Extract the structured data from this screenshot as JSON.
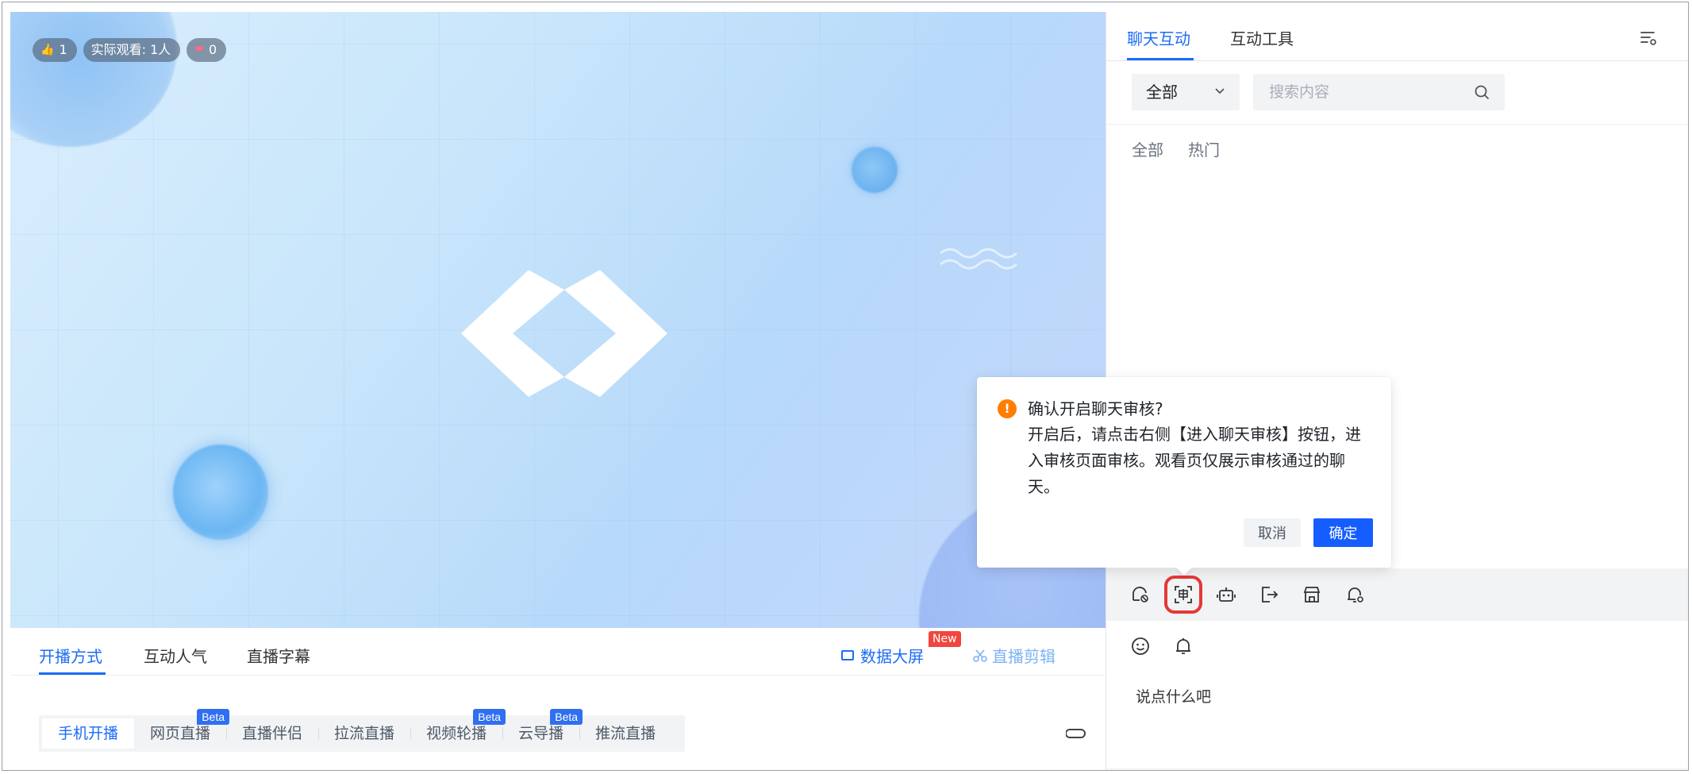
{
  "video": {
    "badges": [
      {
        "icon": "finger-icon",
        "glyph": "👍",
        "value": "1"
      },
      {
        "label": "实际观看: 1人"
      },
      {
        "icon": "heart-icon",
        "glyph": "❤",
        "value": "0"
      }
    ]
  },
  "bottom_tabs": {
    "items": [
      "开播方式",
      "互动人气",
      "直播字幕"
    ],
    "active": "开播方式",
    "data_screen": "数据大屏",
    "new_badge": "New",
    "clip": "直播剪辑"
  },
  "modes": [
    {
      "label": "手机开播",
      "badge": ""
    },
    {
      "label": "网页直播",
      "badge": "Beta"
    },
    {
      "label": "直播伴侣",
      "badge": ""
    },
    {
      "label": "拉流直播",
      "badge": ""
    },
    {
      "label": "视频轮播",
      "badge": "Beta"
    },
    {
      "label": "云导播",
      "badge": "Beta"
    },
    {
      "label": "推流直播",
      "badge": ""
    }
  ],
  "right": {
    "tabs": [
      "聊天互动",
      "互动工具"
    ],
    "select_value": "全部",
    "search_placeholder": "搜索内容",
    "sub_tabs": [
      "全部",
      "热门"
    ],
    "chat_placeholder": "说点什么吧"
  },
  "popover": {
    "title": "确认开启聊天审核?",
    "body": "开启后，请点击右侧【进入聊天审核】按钮，进入审核页面审核。观看页仅展示审核通过的聊天。",
    "cancel": "取消",
    "confirm": "确定"
  },
  "colors": {
    "accent": "#1d6cf3",
    "primary_button": "#165dff",
    "warning": "#ff7d00",
    "new_badge": "#f0463d",
    "highlight": "#e53935"
  }
}
